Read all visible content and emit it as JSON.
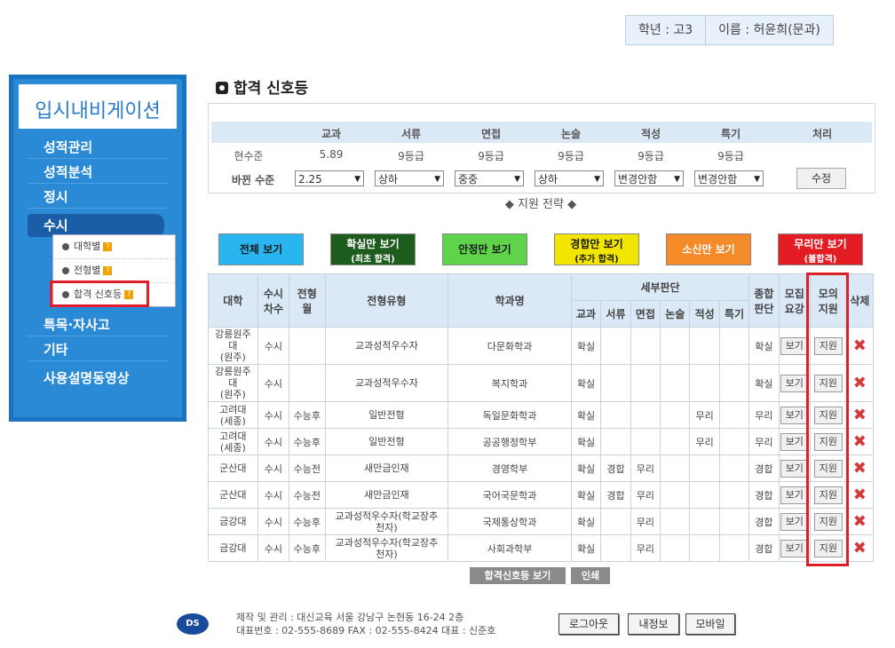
{
  "user": {
    "grade": "학년 : 고3",
    "name": "이름 : 허윤희(문과)"
  },
  "sidebar": {
    "title": "입시내비게이션",
    "menu": [
      "성적관리",
      "성적분석",
      "정시",
      "수시",
      "특목·자사고",
      "기타",
      "사용설명동영상"
    ],
    "submenu": [
      "대학별",
      "전형별",
      "합격 신호등"
    ]
  },
  "page_title": "합격 신호등",
  "levels": {
    "headers": [
      "교과",
      "서류",
      "면접",
      "논술",
      "적성",
      "특기",
      "처리"
    ],
    "current_label": "현수준",
    "current": [
      "5.89",
      "9등급",
      "9등급",
      "9등급",
      "9등급",
      "9등급"
    ],
    "changed_label": "바뀐 수준",
    "selects": [
      "2.25",
      "상하",
      "중중",
      "상하",
      "변경안함",
      "변경안함"
    ],
    "apply": "수정"
  },
  "strategy": "◆ 지원 전략 ◆",
  "filters": [
    {
      "l1": "전체 보기",
      "l2": "",
      "bg": "#29b6f0",
      "fg": "#1a1a1a"
    },
    {
      "l1": "확실만 보기",
      "l2": "(최초 합격)",
      "bg": "#1e5c1e",
      "fg": "#ffffff"
    },
    {
      "l1": "안정만 보기",
      "l2": "",
      "bg": "#5fd44a",
      "fg": "#1a1a1a"
    },
    {
      "l1": "경합만 보기",
      "l2": "(추가 합격)",
      "bg": "#f2e600",
      "fg": "#1a1a1a"
    },
    {
      "l1": "소신만 보기",
      "l2": "",
      "bg": "#f58a28",
      "fg": "#ffffff"
    },
    {
      "l1": "무리만 보기",
      "l2": "(불합격)",
      "bg": "#e31b23",
      "fg": "#ffffff"
    }
  ],
  "table": {
    "h_univ": "대학",
    "h_round": "수시\n차수",
    "h_type": "전형\n월",
    "h_jtype": "전형유형",
    "h_dept": "학과명",
    "h_detail": "세부판단",
    "detail_cols": [
      "교과",
      "서류",
      "면접",
      "논술",
      "적성",
      "특기"
    ],
    "h_total": "종합\n판단",
    "h_guide": "모집\n요강",
    "h_mock": "모의\n지원",
    "h_del": "삭제",
    "view": "보기",
    "apply": "지원",
    "rows": [
      {
        "univ": "강릉원주\n대\n(원주)",
        "round": "수시",
        "type": "",
        "jtype": "교과성적우수자",
        "dept": "다문화학과",
        "d": [
          "확실",
          "",
          "",
          "",
          "",
          ""
        ],
        "dc": [
          "g",
          "",
          "",
          "",
          "",
          ""
        ],
        "total": "확실",
        "tc": "g"
      },
      {
        "univ": "강릉원주\n대\n(원주)",
        "round": "수시",
        "type": "",
        "jtype": "교과성적우수자",
        "dept": "복지학과",
        "d": [
          "확실",
          "",
          "",
          "",
          "",
          ""
        ],
        "dc": [
          "g",
          "",
          "",
          "",
          "",
          ""
        ],
        "total": "확실",
        "tc": "g"
      },
      {
        "univ": "고려대\n(세종)",
        "round": "수시",
        "type": "수능후",
        "jtype": "일반전형",
        "dept": "독일문화학과",
        "d": [
          "확실",
          "",
          "",
          "",
          "무리",
          ""
        ],
        "dc": [
          "g",
          "",
          "",
          "",
          "r",
          ""
        ],
        "total": "무리",
        "tc": "r"
      },
      {
        "univ": "고려대\n(세종)",
        "round": "수시",
        "type": "수능후",
        "jtype": "일반전형",
        "dept": "공공행정학부",
        "d": [
          "확실",
          "",
          "",
          "",
          "무리",
          ""
        ],
        "dc": [
          "g",
          "",
          "",
          "",
          "r",
          ""
        ],
        "total": "무리",
        "tc": "r"
      },
      {
        "univ": "군산대",
        "round": "수시",
        "type": "수능전",
        "jtype": "새만금인재",
        "dept": "경영학부",
        "d": [
          "확실",
          "경합",
          "무리",
          "",
          "",
          ""
        ],
        "dc": [
          "g",
          "o",
          "r",
          "",
          "",
          ""
        ],
        "total": "경합",
        "tc": "o"
      },
      {
        "univ": "군산대",
        "round": "수시",
        "type": "수능전",
        "jtype": "새만금인재",
        "dept": "국어국문학과",
        "d": [
          "확실",
          "경합",
          "무리",
          "",
          "",
          ""
        ],
        "dc": [
          "g",
          "o",
          "r",
          "",
          "",
          ""
        ],
        "total": "경합",
        "tc": "o"
      },
      {
        "univ": "금강대",
        "round": "수시",
        "type": "수능후",
        "jtype": "교과성적우수자(학교장추\n천자)",
        "dept": "국제통상학과",
        "d": [
          "확실",
          "",
          "무리",
          "",
          "",
          ""
        ],
        "dc": [
          "g",
          "",
          "r",
          "",
          "",
          ""
        ],
        "total": "경합",
        "tc": "o"
      },
      {
        "univ": "금강대",
        "round": "수시",
        "type": "수능후",
        "jtype": "교과성적우수자(학교장추\n천자)",
        "dept": "사회과학부",
        "d": [
          "확실",
          "",
          "무리",
          "",
          "",
          ""
        ],
        "dc": [
          "g",
          "",
          "r",
          "",
          "",
          ""
        ],
        "total": "경합",
        "tc": "o"
      }
    ]
  },
  "bottom_buttons": [
    "합격신호등 보기",
    "인쇄"
  ],
  "footer": {
    "logo": "DS",
    "line1": "제작 및 관리 : 대신교육 서울 강남구 논현동 16-24 2층",
    "line2": "대표번호 : 02-555-8689   FAX : 02-555-8424   대표 : 신준호",
    "buttons": [
      "로그아웃",
      "내정보",
      "모바일"
    ]
  }
}
